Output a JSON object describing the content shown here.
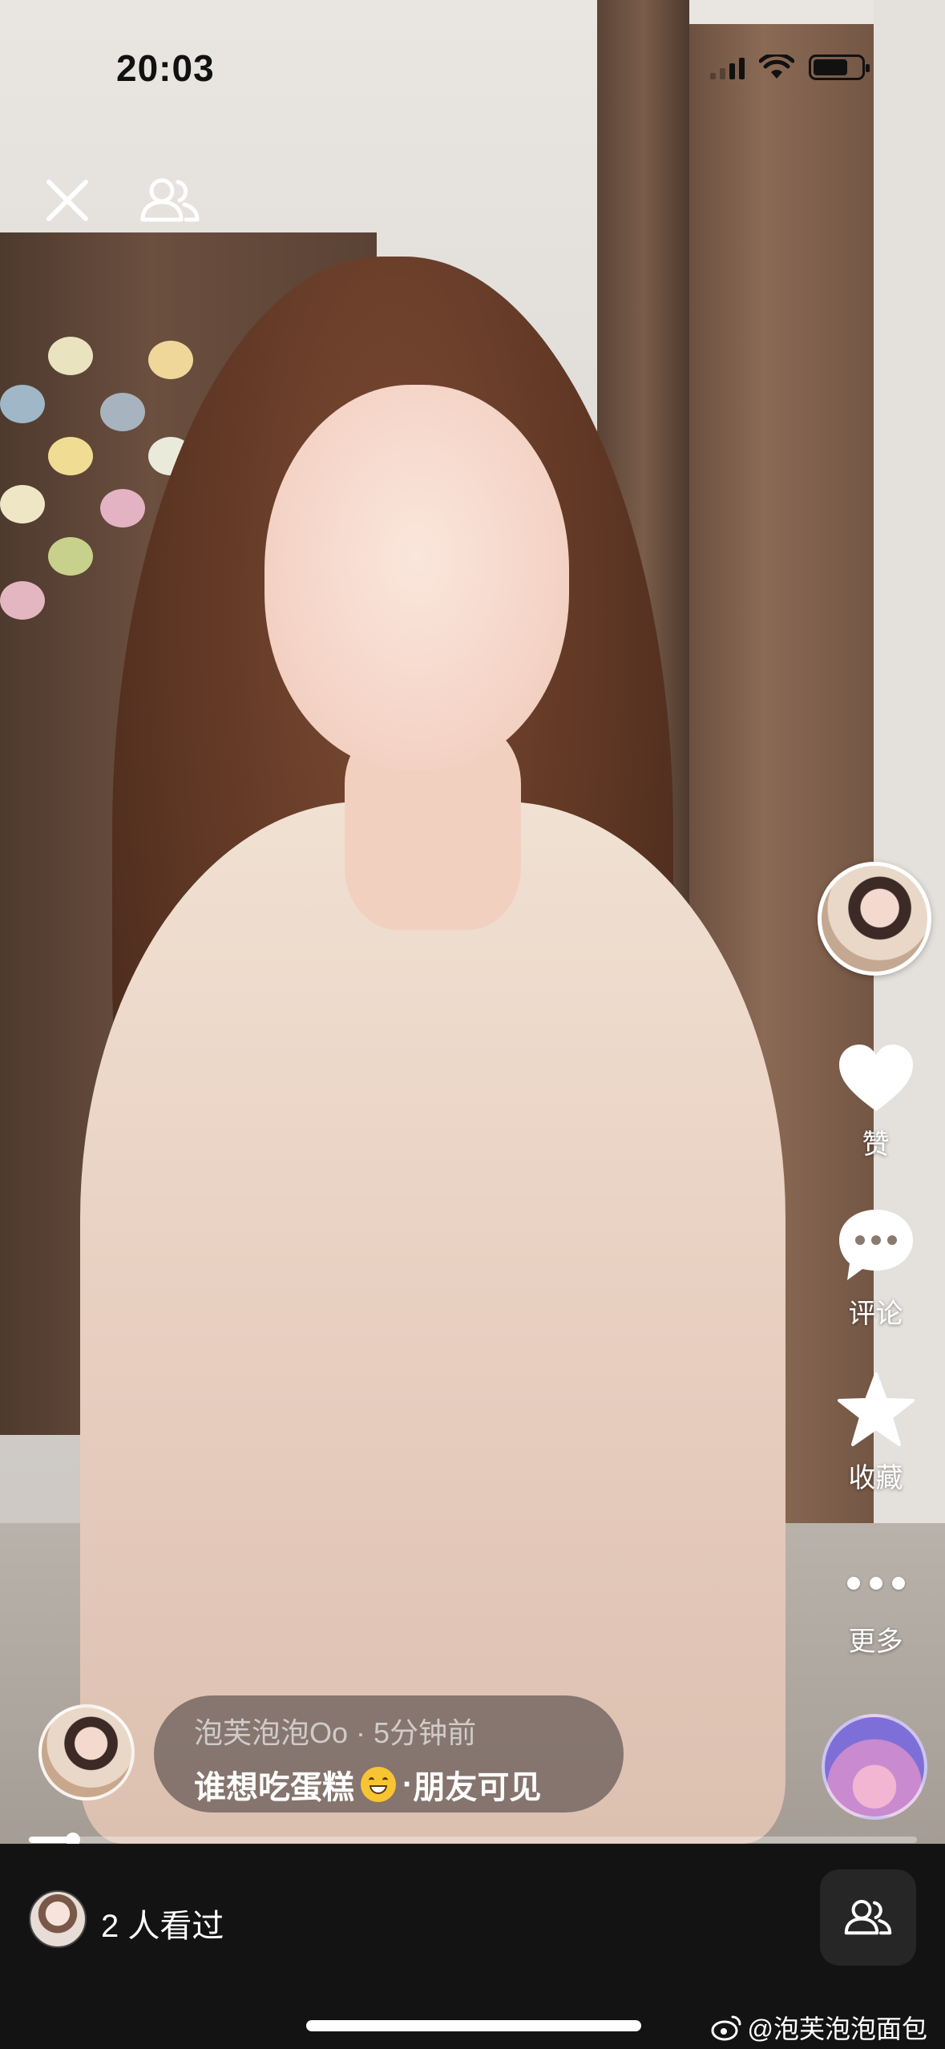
{
  "status_bar": {
    "time": "20:03"
  },
  "top_controls": {
    "close_icon": "close-icon",
    "friends_icon": "friends-icon"
  },
  "rail": {
    "like_label": "赞",
    "comment_label": "评论",
    "favorite_label": "收藏",
    "more_label": "更多"
  },
  "post": {
    "author": "泡芙泡泡Oo",
    "time_ago": "5分钟前",
    "caption_prefix": "谁想吃蛋糕",
    "visibility": "朋友可见",
    "progress": 0.05
  },
  "bottom_bar": {
    "viewers_text": "2 人看过"
  },
  "watermark": {
    "text": "@泡芙泡泡面包"
  },
  "colors": {
    "bottom_bar": "#131313",
    "caption_bg": "rgba(60,55,55,0.55)",
    "icon": "#ffffff"
  }
}
